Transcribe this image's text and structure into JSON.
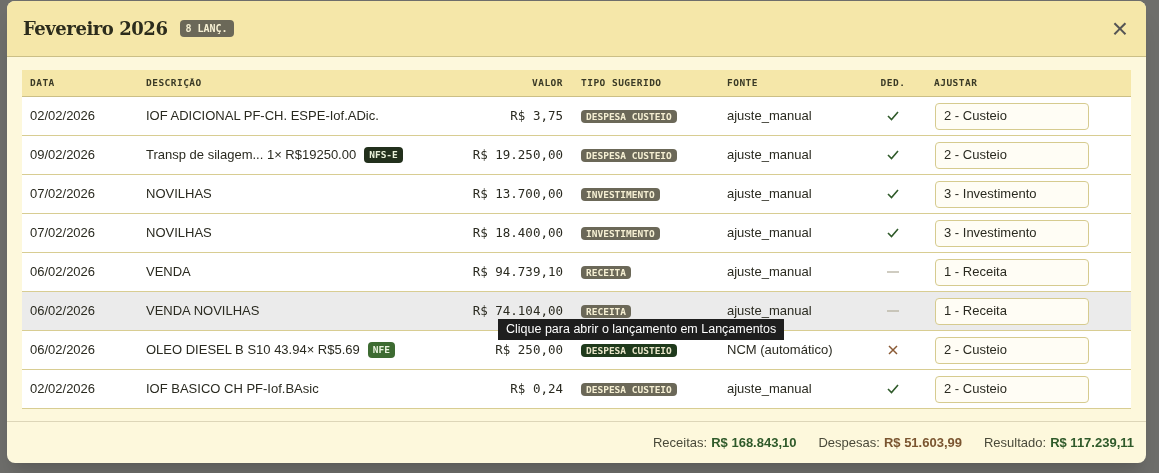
{
  "dialog": {
    "title": "Fevereiro 2026",
    "count_badge": "8 LANÇ.",
    "close": "×"
  },
  "table": {
    "columns": [
      "DATA",
      "DESCRIÇÃO",
      "VALOR",
      "TIPO SUGERIDO",
      "FONTE",
      "DED.",
      "AJUSTAR"
    ],
    "rows": [
      {
        "date": "02/02/2026",
        "description": "IOF ADICIONAL PF-CH. ESPE-Iof.ADic.",
        "value": "R$ 3,75",
        "type": {
          "text": "DESPESA CUSTEIO",
          "kind": "manual"
        },
        "source": "ajuste_manual",
        "ded": {
          "kind": "check"
        },
        "adjust": "2 - Custeio",
        "hovered": false
      },
      {
        "date": "09/02/2026",
        "description": "Transp de silagem... 1× R$19250.00",
        "doc_badge": {
          "text": "NFS-E",
          "kind": "service"
        },
        "value": "R$ 19.250,00",
        "type": {
          "text": "DESPESA CUSTEIO",
          "kind": "manual"
        },
        "source": "ajuste_manual",
        "ded": {
          "kind": "check"
        },
        "adjust": "2 - Custeio",
        "hovered": false
      },
      {
        "date": "07/02/2026",
        "description": "NOVILHAS",
        "value": "R$ 13.700,00",
        "type": {
          "text": "INVESTIMENTO",
          "kind": "manual"
        },
        "source": "ajuste_manual",
        "ded": {
          "kind": "check"
        },
        "adjust": "3 - Investimento",
        "hovered": false
      },
      {
        "date": "07/02/2026",
        "description": "NOVILHAS",
        "value": "R$ 18.400,00",
        "type": {
          "text": "INVESTIMENTO",
          "kind": "manual"
        },
        "source": "ajuste_manual",
        "ded": {
          "kind": "check"
        },
        "adjust": "3 - Investimento",
        "hovered": false
      },
      {
        "date": "06/02/2026",
        "description": "VENDA",
        "value": "R$ 94.739,10",
        "type": {
          "text": "RECEITA",
          "kind": "manual"
        },
        "source": "ajuste_manual",
        "ded": {
          "kind": "dash"
        },
        "adjust": "1 - Receita",
        "hovered": false
      },
      {
        "date": "06/02/2026",
        "description": "VENDA NOVILHAS",
        "value": "R$ 74.104,00",
        "type": {
          "text": "RECEITA",
          "kind": "manual"
        },
        "source": "ajuste_manual",
        "ded": {
          "kind": "dash"
        },
        "adjust": "1 - Receita",
        "hovered": true
      },
      {
        "date": "06/02/2026",
        "description": "OLEO DIESEL B S10 43.94× R$5.69",
        "doc_badge": {
          "text": "NFE",
          "kind": "product"
        },
        "value": "R$ 250,00",
        "type": {
          "text": "DESPESA CUSTEIO",
          "kind": "auto"
        },
        "source": "NCM (automático)",
        "ded": {
          "kind": "cross"
        },
        "adjust": "2 - Custeio",
        "hovered": false
      },
      {
        "date": "02/02/2026",
        "description": "IOF BASICO CH PF-Iof.BAsic",
        "value": "R$ 0,24",
        "type": {
          "text": "DESPESA CUSTEIO",
          "kind": "manual"
        },
        "source": "ajuste_manual",
        "ded": {
          "kind": "check"
        },
        "adjust": "2 - Custeio",
        "hovered": false
      }
    ]
  },
  "tooltip": "Clique para abrir o lançamento em Lançamentos",
  "totals": [
    {
      "label": "Receitas:",
      "value": "R$ 168.843,10",
      "kind": "positive"
    },
    {
      "label": "Despesas:",
      "value": "R$ 51.603,99",
      "kind": "negative"
    },
    {
      "label": "Resultado:",
      "value": "R$ 117.239,11",
      "kind": "positive"
    }
  ]
}
